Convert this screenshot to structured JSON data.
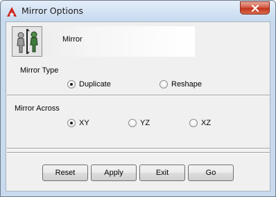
{
  "window": {
    "title": "Mirror Options",
    "close_icon": "close-icon",
    "app_icon": "autodesk-logo-icon"
  },
  "header": {
    "icon": "mirror-figures-icon",
    "label": "Mirror"
  },
  "mirror_type": {
    "label": "Mirror Type",
    "options": [
      {
        "label": "Duplicate",
        "selected": true
      },
      {
        "label": "Reshape",
        "selected": false
      }
    ]
  },
  "mirror_across": {
    "label": "Mirror Across",
    "options": [
      {
        "label": "XY",
        "selected": true
      },
      {
        "label": "YZ",
        "selected": false
      },
      {
        "label": "XZ",
        "selected": false
      }
    ]
  },
  "buttons": {
    "reset": "Reset",
    "apply": "Apply",
    "exit": "Exit",
    "go": "Go"
  },
  "colors": {
    "close_button": "#c9412b",
    "logo": "#d0241c"
  }
}
